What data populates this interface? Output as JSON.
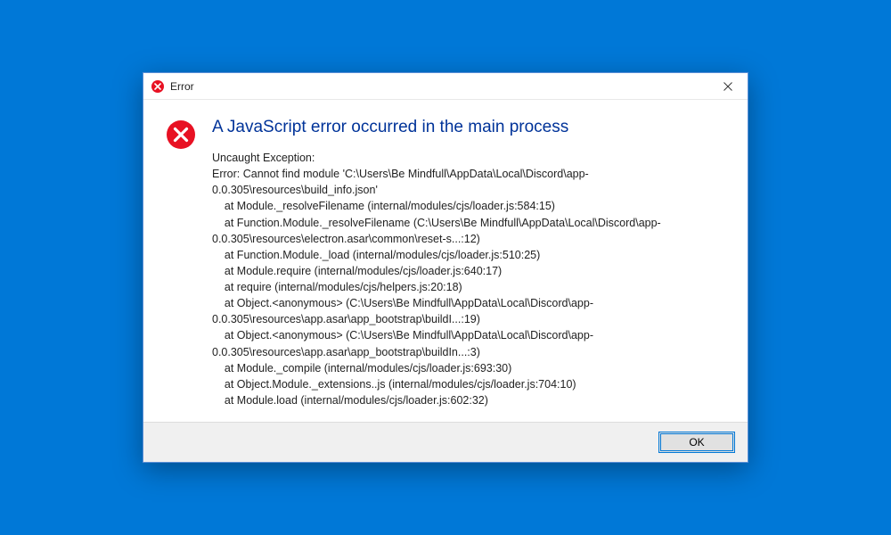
{
  "titlebar": {
    "title": "Error",
    "close_label": "Close"
  },
  "dialog": {
    "heading": "A JavaScript error occurred in the main process",
    "body": "Uncaught Exception:\nError: Cannot find module 'C:\\Users\\Be Mindfull\\AppData\\Local\\Discord\\app-0.0.305\\resources\\build_info.json'\n    at Module._resolveFilename (internal/modules/cjs/loader.js:584:15)\n    at Function.Module._resolveFilename (C:\\Users\\Be Mindfull\\AppData\\Local\\Discord\\app-0.0.305\\resources\\electron.asar\\common\\reset-s...:12)\n    at Function.Module._load (internal/modules/cjs/loader.js:510:25)\n    at Module.require (internal/modules/cjs/loader.js:640:17)\n    at require (internal/modules/cjs/helpers.js:20:18)\n    at Object.<anonymous> (C:\\Users\\Be Mindfull\\AppData\\Local\\Discord\\app-0.0.305\\resources\\app.asar\\app_bootstrap\\buildI...:19)\n    at Object.<anonymous> (C:\\Users\\Be Mindfull\\AppData\\Local\\Discord\\app-0.0.305\\resources\\app.asar\\app_bootstrap\\buildIn...:3)\n    at Module._compile (internal/modules/cjs/loader.js:693:30)\n    at Object.Module._extensions..js (internal/modules/cjs/loader.js:704:10)\n    at Module.load (internal/modules/cjs/loader.js:602:32)"
  },
  "buttons": {
    "ok_label": "OK"
  },
  "icons": {
    "error": "error-icon",
    "close": "close-icon"
  },
  "colors": {
    "background": "#0078d7",
    "heading": "#003399",
    "error_red": "#e81123"
  }
}
